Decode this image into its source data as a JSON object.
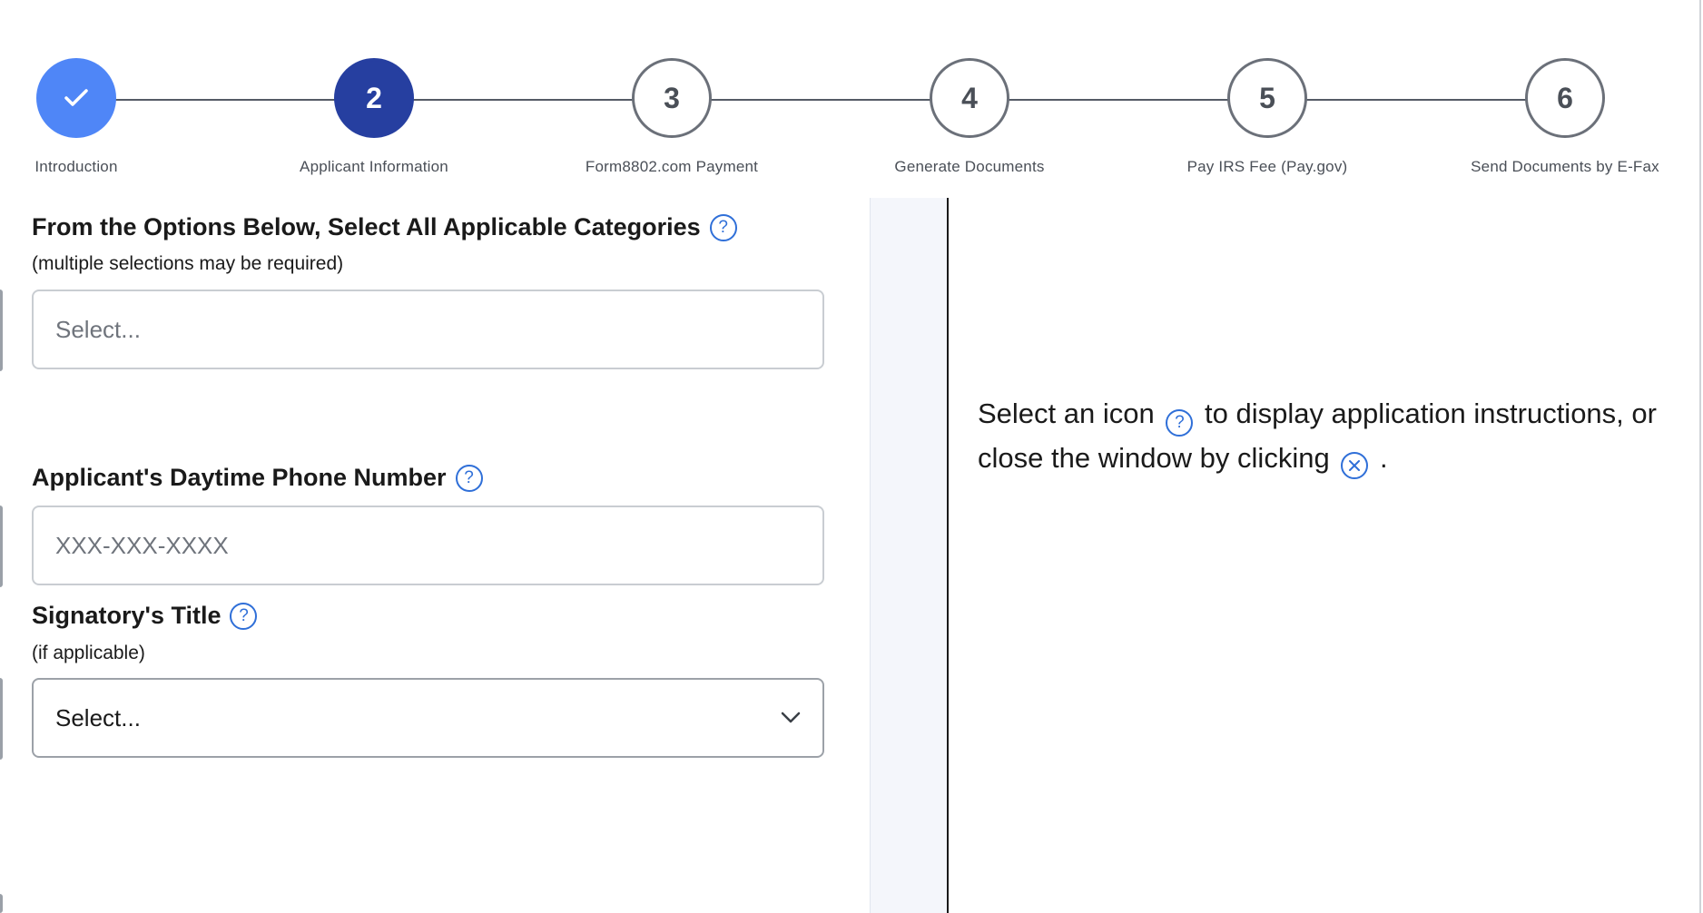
{
  "stepper": {
    "steps": [
      {
        "number": "✓",
        "label": "Introduction",
        "state": "done"
      },
      {
        "number": "2",
        "label": "Applicant Information",
        "state": "active"
      },
      {
        "number": "3",
        "label": "Form8802.com Payment",
        "state": "pending"
      },
      {
        "number": "4",
        "label": "Generate Documents",
        "state": "pending"
      },
      {
        "number": "5",
        "label": "Pay IRS Fee (Pay.gov)",
        "state": "pending"
      },
      {
        "number": "6",
        "label": "Send Documents by E-Fax",
        "state": "pending"
      }
    ]
  },
  "form": {
    "categories": {
      "label": "From the Options Below, Select All Applicable Categories",
      "sublabel": "(multiple selections may be required)",
      "placeholder": "Select..."
    },
    "phone": {
      "label": "Applicant's Daytime Phone Number",
      "placeholder": "XXX-XXX-XXXX"
    },
    "signatory": {
      "label": "Signatory's Title",
      "sublabel": "(if applicable)",
      "value": "Select..."
    }
  },
  "help_panel": {
    "text_part1": "Select an icon",
    "text_part2": "to display application instructions, or close the window by clicking",
    "text_part3": "."
  },
  "icons": {
    "help": "question-circle-icon",
    "close": "close-circle-icon",
    "check": "check-icon",
    "chevron": "chevron-down-icon"
  },
  "colors": {
    "done": "#4f86f7",
    "active": "#263fa0",
    "link_blue": "#2f6fd8"
  }
}
